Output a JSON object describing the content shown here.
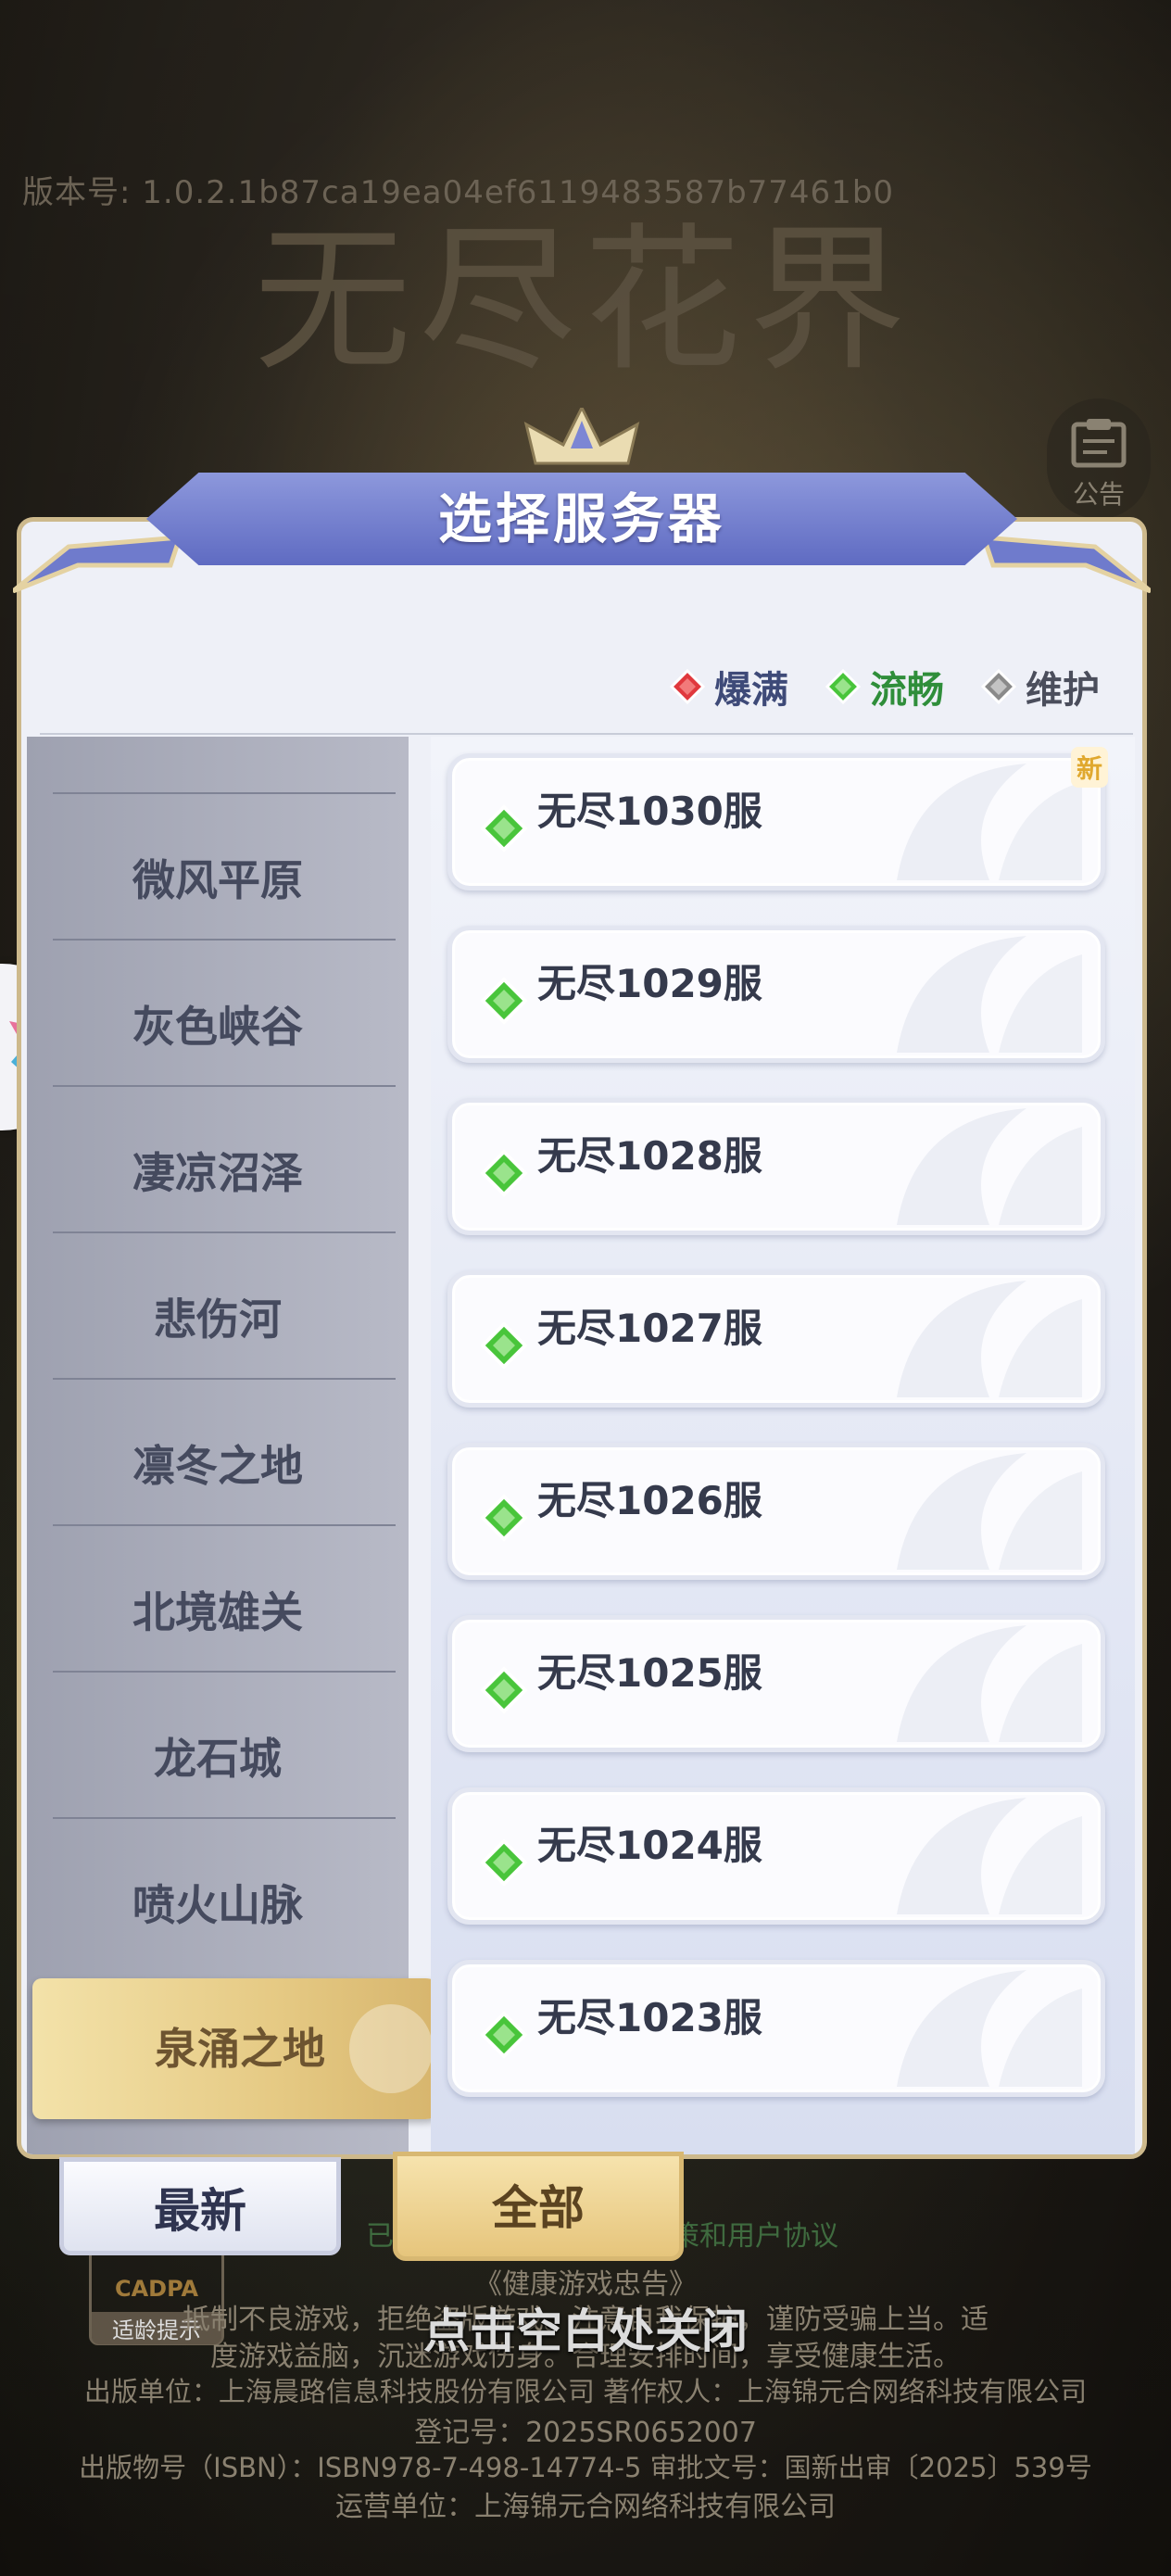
{
  "background": {
    "version_text": "版本号: 1.0.2.1b87ca19ea04ef6119483587b77461b0",
    "game_logo": "无尽花界",
    "notice_label": "公告",
    "agreement_text": "已详细阅读并同意隐私政策和用户协议",
    "health_title": "《健康游戏忠告》",
    "health_line1": "抵制不良游戏，拒绝盗版游戏。注意自我保护，谨防受骗上当。适",
    "health_line2": "度游戏益脑，沉迷游戏伤身。合理安排时间，享受健康生活。",
    "publisher": "出版单位：上海晨路信息科技股份有限公司 著作权人：上海锦元合网络科技有限公司",
    "registration": "登记号：2025SR0652007",
    "isbn": "出版物号（ISBN）：ISBN978-7-498-14774-5 审批文号：国新出审〔2025〕539号",
    "operator": "运营单位：上海锦元合网络科技有限公司",
    "cadpa_mark": "CADPA",
    "cadpa_label": "适龄提示",
    "close_hint": "点击空白处关闭"
  },
  "panel": {
    "title": "选择服务器",
    "legend": [
      {
        "label": "爆满",
        "color": "#e0383d"
      },
      {
        "label": "流畅",
        "color": "#49c53b"
      },
      {
        "label": "维护",
        "color": "#8a8a8a"
      }
    ],
    "regions": [
      {
        "label": "微风平原"
      },
      {
        "label": "灰色峡谷"
      },
      {
        "label": "凄凉沼泽"
      },
      {
        "label": "悲伤河"
      },
      {
        "label": "凛冬之地"
      },
      {
        "label": "北境雄关"
      },
      {
        "label": "龙石城"
      },
      {
        "label": "喷火山脉"
      },
      {
        "label": "泉涌之地"
      }
    ],
    "active_region": "泉涌之地",
    "servers": [
      {
        "name": "无尽1030服",
        "status": "流畅",
        "tag": "新"
      },
      {
        "name": "无尽1029服",
        "status": "流畅"
      },
      {
        "name": "无尽1028服",
        "status": "流畅"
      },
      {
        "name": "无尽1027服",
        "status": "流畅"
      },
      {
        "name": "无尽1026服",
        "status": "流畅"
      },
      {
        "name": "无尽1025服",
        "status": "流畅"
      },
      {
        "name": "无尽1024服",
        "status": "流畅"
      },
      {
        "name": "无尽1023服",
        "status": "流畅"
      }
    ]
  },
  "tabs": {
    "latest": "最新",
    "all": "全部",
    "selected": "全部"
  },
  "colors": {
    "header_blue": "#6a76c8",
    "gold_accent": "#e5c983",
    "status_smooth": "#49c53b",
    "status_full": "#e0383d",
    "status_maint": "#8a8a8a"
  }
}
